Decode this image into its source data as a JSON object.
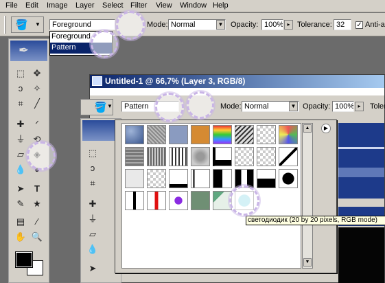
{
  "menu": [
    "File",
    "Edit",
    "Image",
    "Layer",
    "Select",
    "Filter",
    "View",
    "Window",
    "Help"
  ],
  "options_bar": {
    "fill_source": "Foreground",
    "mode_label": "Mode:",
    "mode_value": "Normal",
    "opacity_label": "Opacity:",
    "opacity_value": "100%",
    "tolerance_label": "Tolerance:",
    "tolerance_value": "32",
    "antialias_label": "Anti-al"
  },
  "fill_dropdown": {
    "options": [
      "Foreground",
      "Pattern"
    ],
    "selected": "Pattern"
  },
  "document": {
    "title": "Untitled-1 @ 66,7% (Layer 3, RGB/8)",
    "fill_source": "Pattern",
    "mode_label": "Mode:",
    "mode_value": "Normal",
    "opacity_label": "Opacity:",
    "opacity_value": "100%",
    "tolerance_label": "Toler"
  },
  "pattern_tooltip": "светодиодик (20 by 20 pixels, RGB mode)",
  "colors": {
    "ui_gray": "#d4d0c8",
    "title_blue": "#0a246a",
    "highlight_ring": "#c9b5e6",
    "tooltip_bg": "#ffffe1"
  }
}
